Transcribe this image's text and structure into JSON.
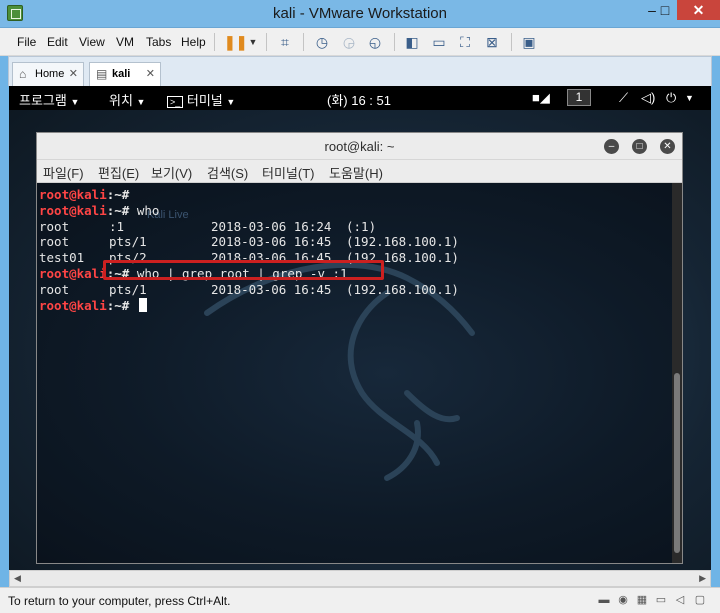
{
  "window": {
    "title": "kali - VMware Workstation",
    "min": "–",
    "max": "□",
    "close": "✕"
  },
  "menu": [
    "File",
    "Edit",
    "View",
    "VM",
    "Tabs",
    "Help"
  ],
  "tabs": [
    {
      "label": "Home",
      "icon": "home-icon"
    },
    {
      "label": "kali",
      "icon": "vm-icon",
      "close": "✕"
    }
  ],
  "gnome": {
    "activities": "프로그램",
    "places": "위치",
    "app": "터미널",
    "clock": "(화) 16 : 51",
    "workspace": "1"
  },
  "terminal": {
    "title": "root@kali: ~",
    "menu": [
      "파일(F)",
      "편집(E)",
      "보기(V)",
      "검색(S)",
      "터미널(T)",
      "도움말(H)"
    ],
    "prompt_user": "root@kali",
    "prompt_sep": ":~#",
    "watermark": "Kali Live",
    "lines": [
      {
        "type": "prompt",
        "cmd": ""
      },
      {
        "type": "prompt",
        "cmd": " who"
      },
      {
        "type": "row",
        "user": "root",
        "tty": ":1",
        "date": "2018-03-06 16:24",
        "host": "(:1)"
      },
      {
        "type": "row",
        "user": "root",
        "tty": "pts/1",
        "date": "2018-03-06 16:45",
        "host": "(192.168.100.1)"
      },
      {
        "type": "row",
        "user": "test01",
        "tty": "pts/2",
        "date": "2018-03-06 16:45",
        "host": "(192.168.100.1)"
      },
      {
        "type": "prompt",
        "cmd": " who | grep root | grep -v :1"
      },
      {
        "type": "row",
        "user": "root",
        "tty": "pts/1",
        "date": "2018-03-06 16:45",
        "host": "(192.168.100.1)"
      },
      {
        "type": "prompt",
        "cmd": " ",
        "cursor": true
      }
    ]
  },
  "status": {
    "text": "To return to your computer, press Ctrl+Alt."
  }
}
